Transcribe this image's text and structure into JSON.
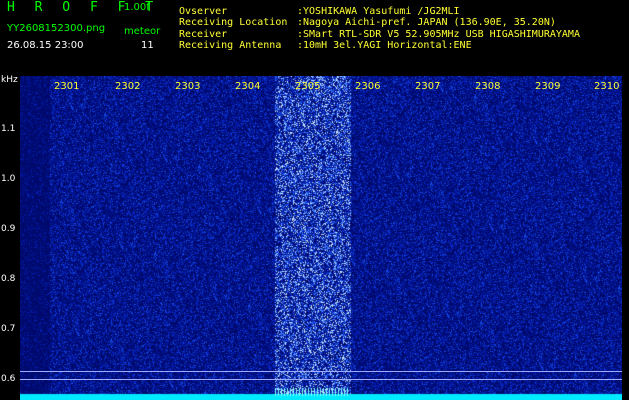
{
  "header": {
    "app_title": "H R O F F T",
    "version": "1.00f",
    "filename": "YY2608152300.png",
    "mode": "meteor",
    "datetime": "26.08.15 23:00",
    "count": "11",
    "info": [
      {
        "label": "Ovserver",
        "value": ":YOSHIKAWA Yasufumi /JG2MLI"
      },
      {
        "label": "Receiving Location",
        "value": ":Nagoya Aichi-pref. JAPAN (136.90E, 35.20N)"
      },
      {
        "label": "Receiver",
        "value": ":SMart RTL-SDR V5 52.905MHz USB HIGASHIMURAYAMA"
      },
      {
        "label": "Receiving Antenna",
        "value": ":10mH 3el.YAGI Horizontal:ENE"
      }
    ]
  },
  "axis": {
    "unit": "kHz",
    "y_ticks": [
      "1.1",
      "1.0",
      "0.9",
      "0.8",
      "0.7",
      "0.6"
    ],
    "x_ticks": [
      "2301",
      "2302",
      "2303",
      "2304",
      "2305",
      "2306",
      "2307",
      "2308",
      "2309",
      "2310"
    ]
  },
  "colors": {
    "background": "#000000",
    "header_green": "#00ff00",
    "header_yellow": "#ffff33",
    "spectrogram_base": "#000f8c",
    "signal_band": "#00ffff"
  }
}
